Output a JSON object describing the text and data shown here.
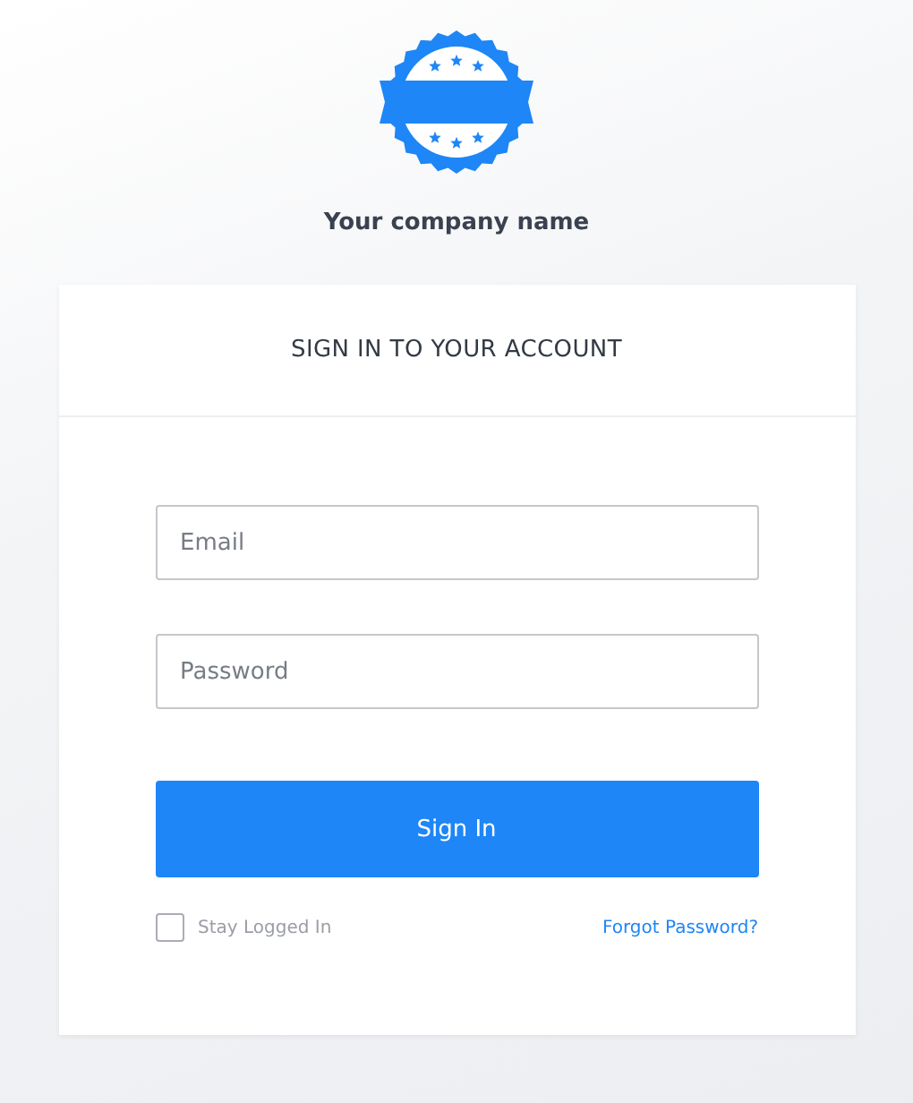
{
  "company": {
    "name": "Your company name"
  },
  "card": {
    "title": "SIGN IN TO YOUR ACCOUNT"
  },
  "fields": [
    {
      "placeholder": "Email"
    },
    {
      "placeholder": "Password"
    }
  ],
  "submit": {
    "label": "Sign In"
  },
  "remember": {
    "label": "Stay Logged In",
    "checked": false
  },
  "forgot": {
    "label": "Forgot Password?"
  }
}
